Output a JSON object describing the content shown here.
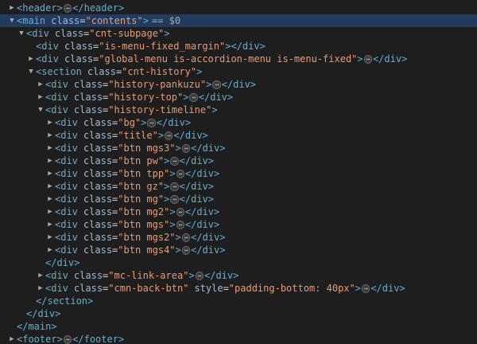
{
  "panel": "elements-tree",
  "colors": {
    "background": "#1e1e1e",
    "selection": "#223a5e",
    "tag": "#5db0d7",
    "attribute_name": "#9bbbdc",
    "attribute_value": "#f29766"
  },
  "selected_suffix": "== $0",
  "ellipsis": "⋯",
  "nodes": [
    {
      "indent": 0,
      "toggle": "collapsed",
      "tag": "header",
      "attrs": [],
      "has_children_collapsed": true,
      "close": "</header>"
    },
    {
      "indent": 0,
      "toggle": "expanded",
      "tag": "main",
      "attrs": [
        {
          "name": "class",
          "value": "\"contents\""
        }
      ],
      "selected": true,
      "close": ""
    },
    {
      "indent": 1,
      "toggle": "expanded",
      "tag": "div",
      "attrs": [
        {
          "name": "class",
          "value": "\"cnt-subpage\""
        }
      ],
      "close": ""
    },
    {
      "indent": 2,
      "toggle": "none",
      "tag": "div",
      "attrs": [
        {
          "name": "class",
          "value": "\"is-menu-fixed_margin\""
        }
      ],
      "close": "</div>"
    },
    {
      "indent": 2,
      "toggle": "collapsed",
      "tag": "div",
      "attrs": [
        {
          "name": "class",
          "value": "\"global-menu is-accordion-menu is-menu-fixed\""
        }
      ],
      "has_children_collapsed": true,
      "close": "</div>"
    },
    {
      "indent": 2,
      "toggle": "expanded",
      "tag": "section",
      "attrs": [
        {
          "name": "class",
          "value": "\"cnt-history\""
        }
      ],
      "close": ""
    },
    {
      "indent": 3,
      "toggle": "collapsed",
      "tag": "div",
      "attrs": [
        {
          "name": "class",
          "value": "\"history-pankuzu\""
        }
      ],
      "has_children_collapsed": true,
      "close": "</div>"
    },
    {
      "indent": 3,
      "toggle": "collapsed",
      "tag": "div",
      "attrs": [
        {
          "name": "class",
          "value": "\"history-top\""
        }
      ],
      "has_children_collapsed": true,
      "close": "</div>"
    },
    {
      "indent": 3,
      "toggle": "expanded",
      "tag": "div",
      "attrs": [
        {
          "name": "class",
          "value": "\"history-timeline\""
        }
      ],
      "close": ""
    },
    {
      "indent": 4,
      "toggle": "collapsed",
      "tag": "div",
      "attrs": [
        {
          "name": "class",
          "value": "\"bg\""
        }
      ],
      "has_children_collapsed": true,
      "close": "</div>"
    },
    {
      "indent": 4,
      "toggle": "collapsed",
      "tag": "div",
      "attrs": [
        {
          "name": "class",
          "value": "\"title\""
        }
      ],
      "has_children_collapsed": true,
      "close": "</div>"
    },
    {
      "indent": 4,
      "toggle": "collapsed",
      "tag": "div",
      "attrs": [
        {
          "name": "class",
          "value": "\"btn mgs3\""
        }
      ],
      "has_children_collapsed": true,
      "close": "</div>"
    },
    {
      "indent": 4,
      "toggle": "collapsed",
      "tag": "div",
      "attrs": [
        {
          "name": "class",
          "value": "\"btn pw\""
        }
      ],
      "has_children_collapsed": true,
      "close": "</div>"
    },
    {
      "indent": 4,
      "toggle": "collapsed",
      "tag": "div",
      "attrs": [
        {
          "name": "class",
          "value": "\"btn tpp\""
        }
      ],
      "has_children_collapsed": true,
      "close": "</div>"
    },
    {
      "indent": 4,
      "toggle": "collapsed",
      "tag": "div",
      "attrs": [
        {
          "name": "class",
          "value": "\"btn gz\""
        }
      ],
      "has_children_collapsed": true,
      "close": "</div>"
    },
    {
      "indent": 4,
      "toggle": "collapsed",
      "tag": "div",
      "attrs": [
        {
          "name": "class",
          "value": "\"btn mg\""
        }
      ],
      "has_children_collapsed": true,
      "close": "</div>"
    },
    {
      "indent": 4,
      "toggle": "collapsed",
      "tag": "div",
      "attrs": [
        {
          "name": "class",
          "value": "\"btn mg2\""
        }
      ],
      "has_children_collapsed": true,
      "close": "</div>"
    },
    {
      "indent": 4,
      "toggle": "collapsed",
      "tag": "div",
      "attrs": [
        {
          "name": "class",
          "value": "\"btn mgs\""
        }
      ],
      "has_children_collapsed": true,
      "close": "</div>"
    },
    {
      "indent": 4,
      "toggle": "collapsed",
      "tag": "div",
      "attrs": [
        {
          "name": "class",
          "value": "\"btn mgs2\""
        }
      ],
      "has_children_collapsed": true,
      "close": "</div>"
    },
    {
      "indent": 4,
      "toggle": "collapsed",
      "tag": "div",
      "attrs": [
        {
          "name": "class",
          "value": "\"btn mgs4\""
        }
      ],
      "has_children_collapsed": true,
      "close": "</div>"
    },
    {
      "indent": 3,
      "toggle": "none",
      "closing_only": true,
      "close": "</div>"
    },
    {
      "indent": 3,
      "toggle": "collapsed",
      "tag": "div",
      "attrs": [
        {
          "name": "class",
          "value": "\"mc-link-area\""
        }
      ],
      "has_children_collapsed": true,
      "close": "</div>"
    },
    {
      "indent": 3,
      "toggle": "collapsed",
      "tag": "div",
      "attrs": [
        {
          "name": "class",
          "value": "\"cmn-back-btn\""
        },
        {
          "name": "style",
          "value": "\"padding-bottom: 40px\""
        }
      ],
      "has_children_collapsed": true,
      "close": "</div>"
    },
    {
      "indent": 2,
      "toggle": "none",
      "closing_only": true,
      "close": "</section>"
    },
    {
      "indent": 1,
      "toggle": "none",
      "closing_only": true,
      "close": "</div>"
    },
    {
      "indent": 0,
      "toggle": "none",
      "closing_only": true,
      "close": "</main>"
    },
    {
      "indent": 0,
      "toggle": "collapsed",
      "tag": "footer",
      "attrs": [],
      "has_children_collapsed": true,
      "close": "</footer>"
    }
  ]
}
